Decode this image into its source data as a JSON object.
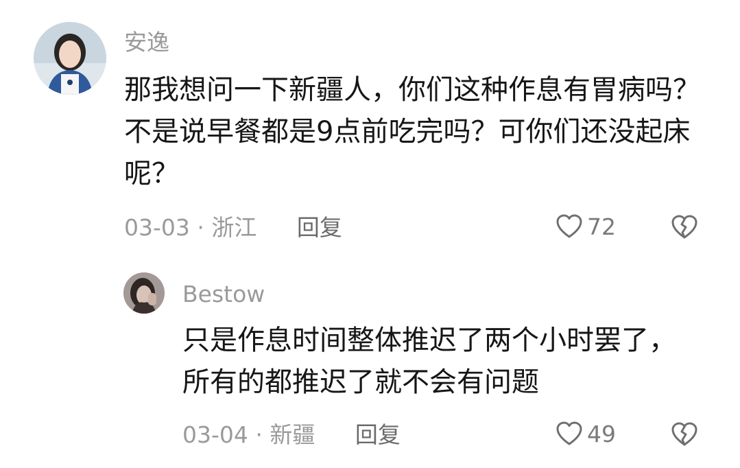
{
  "comment": {
    "username": "安逸",
    "text": "那我想问一下新疆人，你们这种作息有胃病吗？不是说早餐都是9点前吃完吗？可你们还没起床呢？",
    "date": "03-03",
    "location": "浙江",
    "separator": "·",
    "reply_label": "回复",
    "likes": "72",
    "like_icon": "heart-outline-icon",
    "dislike_icon": "broken-heart-icon"
  },
  "reply": {
    "username": "Bestow",
    "text": "只是作息时间整体推迟了两个小时罢了，所有的都推迟了就不会有问题",
    "date": "03-04",
    "location": "新疆",
    "separator": "·",
    "reply_label": "回复",
    "likes": "49",
    "like_icon": "heart-outline-icon",
    "dislike_icon": "broken-heart-icon"
  },
  "colors": {
    "text": "#161616",
    "muted": "#9a9a9a",
    "reply_link": "#6b6b6b"
  }
}
